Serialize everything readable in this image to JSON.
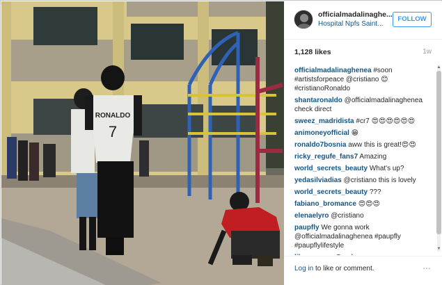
{
  "post": {
    "username": "officialmadalinaghe...",
    "location": "Hospital Npfs Saint...",
    "follow_label": "FOLLOW",
    "likes": "1,128 likes",
    "time": "1w",
    "jersey_name": "RONALDO",
    "jersey_number": "7"
  },
  "comments": [
    {
      "user": "officialmadalinaghenea",
      "text": " #soon #artistsforpeace @cristiano 😊 #cristianoRonaldo"
    },
    {
      "user": "shantaronaldo",
      "text": " @officialmadalinaghenea check direct"
    },
    {
      "user": "sweez_madridista",
      "text": " #cr7 😍😍😍😍😍😍"
    },
    {
      "user": "animoneyofficial",
      "text": " 😁"
    },
    {
      "user": "ronaldo7bosnia",
      "text": " aww this is great!😍😍"
    },
    {
      "user": "ricky_regufe_fans7",
      "text": " Amazing"
    },
    {
      "user": "world_secrets_beauty",
      "text": " What's up?"
    },
    {
      "user": "yedasilviadias",
      "text": " @cristiano this is lovely"
    },
    {
      "user": "world_secrets_beauty",
      "text": " ???"
    },
    {
      "user": "fabiano_bromance",
      "text": " 😍😍😍"
    },
    {
      "user": "elenaelyro",
      "text": " @cristiano"
    },
    {
      "user": "paupfly",
      "text": " We gonna work @officialmadalinaghenea #paupfly #paupflylifestyle"
    },
    {
      "user": "lilpuppypop",
      "text": " Good"
    }
  ],
  "footer": {
    "login_link": "Log in",
    "login_rest": " to like or comment.",
    "more_icon": "⋯"
  },
  "icons": {
    "avatar": "profile-avatar-icon",
    "more": "more-options-icon"
  },
  "colors": {
    "link": "#125688",
    "follow": "#3897f0"
  }
}
